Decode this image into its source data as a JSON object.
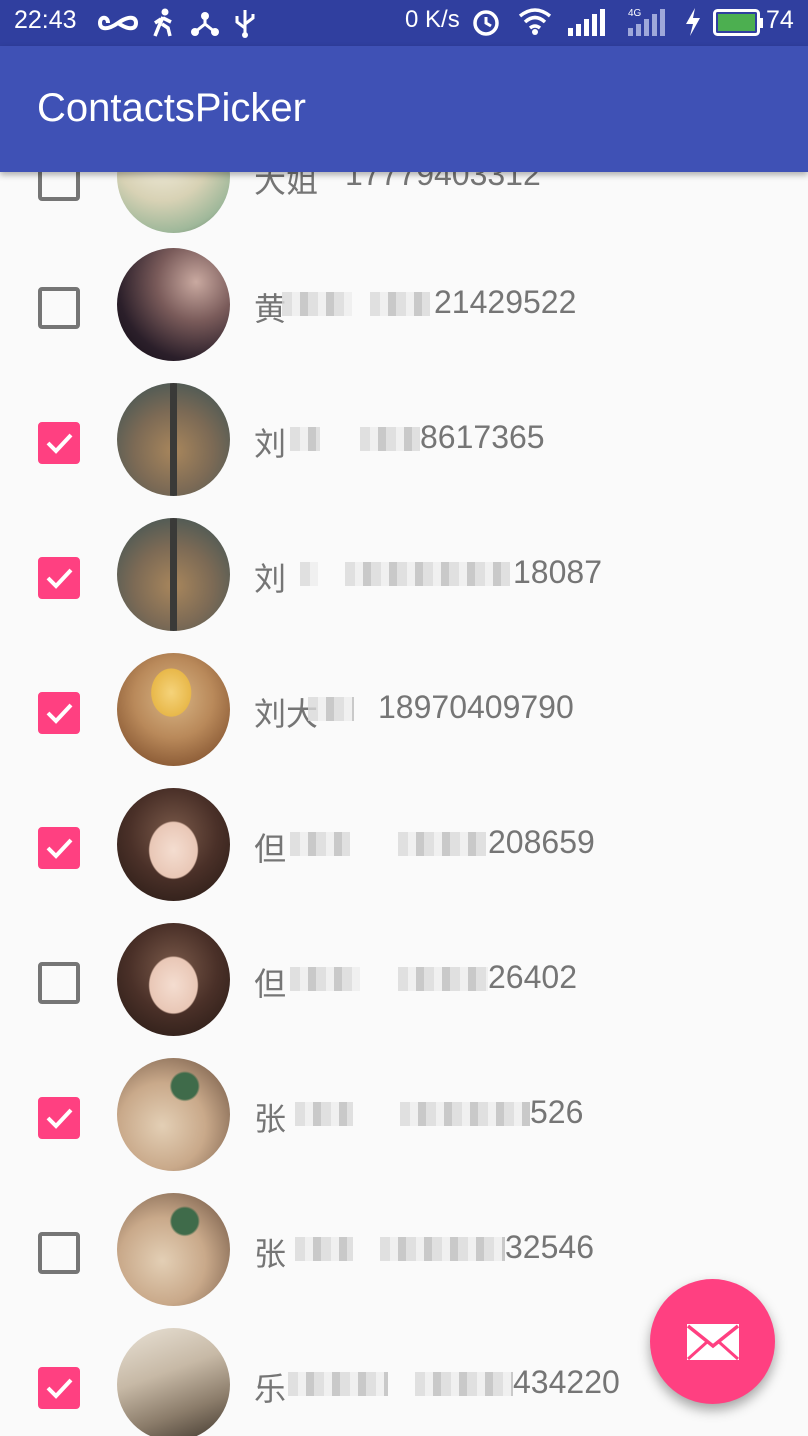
{
  "status_bar": {
    "time": "22:43",
    "net_speed": "0 K/s",
    "battery": "74",
    "icons": [
      "infinity-icon",
      "walking-icon",
      "share-icon",
      "usb-icon",
      "alarm-icon",
      "wifi-icon",
      "signal-icon",
      "signal-4g-icon",
      "charging-icon",
      "battery-icon"
    ]
  },
  "app_bar": {
    "title": "ContactsPicker"
  },
  "contacts": [
    {
      "name": "大姐",
      "phone": "17779403312",
      "checked": false
    },
    {
      "name": "黄",
      "phone": "21429522",
      "checked": false
    },
    {
      "name": "刘",
      "phone": "8617365",
      "checked": true
    },
    {
      "name": "刘",
      "phone": "18087",
      "checked": true
    },
    {
      "name": "刘大",
      "phone": "18970409790",
      "checked": true
    },
    {
      "name": "但",
      "phone": "208659",
      "checked": true
    },
    {
      "name": "但",
      "phone": "26402",
      "checked": false
    },
    {
      "name": "张",
      "phone": "526",
      "checked": true
    },
    {
      "name": "张",
      "phone": "32546",
      "checked": false
    },
    {
      "name": "乐",
      "phone": "434220",
      "checked": true
    }
  ],
  "fab": {
    "icon": "mail-icon"
  },
  "colors": {
    "primary": "#3f51b5",
    "primary_dark": "#303f9f",
    "accent": "#ff4081"
  }
}
